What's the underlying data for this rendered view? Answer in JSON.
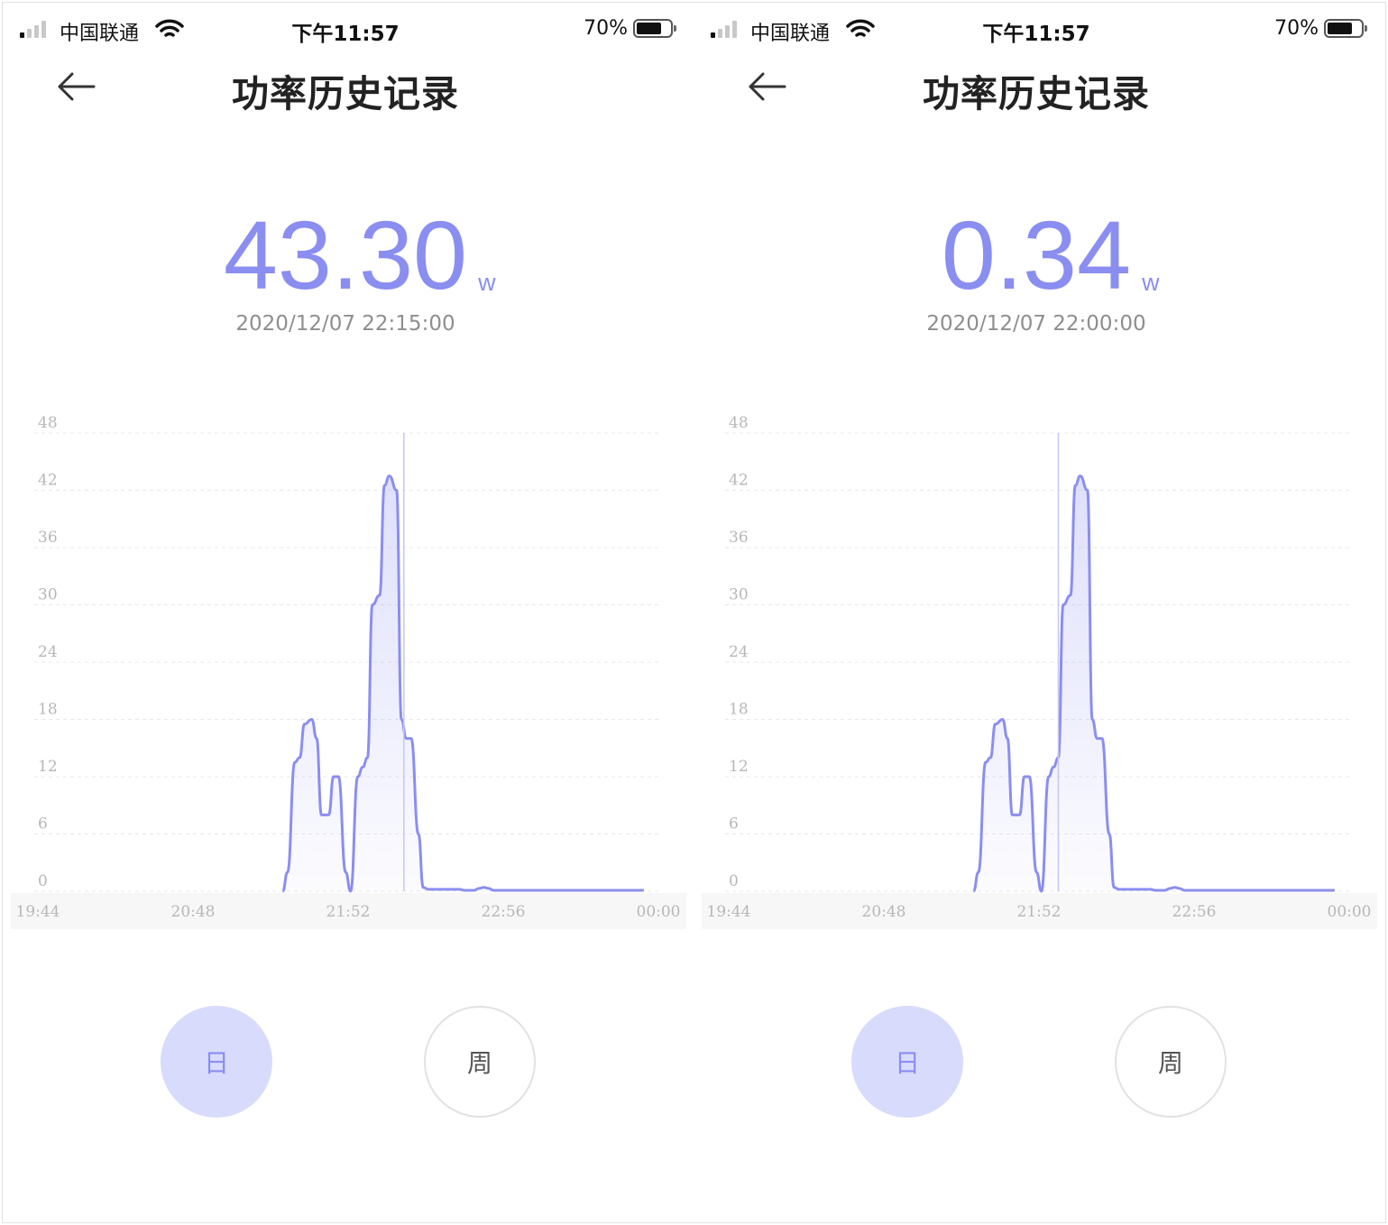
{
  "colors": {
    "accent": "#8a8ef0",
    "active_button_bg": "#d8dbfb",
    "grid": "#e8e8e8",
    "axis_text": "#b7b7b7"
  },
  "icons": [
    "signal-bars-icon",
    "wifi-icon",
    "battery-icon",
    "back-arrow-icon"
  ],
  "status_bar": {
    "carrier": "中国联通",
    "time": "下午11:57",
    "battery_percent": "70%"
  },
  "header": {
    "title": "功率历史记录"
  },
  "screens": [
    {
      "value": "43.30",
      "unit": "W",
      "timestamp": "2020/12/07 22:15:00",
      "buttons": {
        "day": "日",
        "week": "周",
        "selected": "day"
      },
      "cursor_time": "22:15"
    },
    {
      "value": "0.34",
      "unit": "W",
      "timestamp": "2020/12/07 22:00:00",
      "buttons": {
        "day": "日",
        "week": "周",
        "selected": "day"
      },
      "cursor_time": "22:00"
    }
  ],
  "chart_data": {
    "type": "area",
    "title": "",
    "xlabel": "",
    "ylabel": "",
    "y_ticks": [
      "0",
      "6",
      "12",
      "18",
      "24",
      "30",
      "36",
      "42",
      "48"
    ],
    "ylim": [
      0,
      48
    ],
    "x_ticks": [
      "19:44",
      "20:48",
      "21:52",
      "22:56",
      "00:00"
    ],
    "xlim": [
      "19:44",
      "00:00"
    ],
    "grid": "horizontal dashed",
    "series": [
      {
        "x": [
          "21:25",
          "21:27",
          "21:30",
          "21:32",
          "21:34",
          "21:37",
          "21:39",
          "21:41",
          "21:44",
          "21:46",
          "21:48",
          "21:51",
          "21:53",
          "21:56",
          "21:58",
          "22:00",
          "22:02",
          "22:05",
          "22:07",
          "22:09",
          "22:12",
          "22:14",
          "22:16",
          "22:18",
          "22:21",
          "22:23",
          "22:25",
          "22:28",
          "22:30",
          "22:32",
          "22:35",
          "22:38",
          "22:40",
          "22:44",
          "22:46",
          "22:48",
          "22:50",
          "22:52",
          "22:56",
          "23:06",
          "23:20",
          "23:40",
          "23:54"
        ],
        "values": [
          0,
          2,
          13.5,
          14,
          17.5,
          18,
          16,
          8,
          8,
          12,
          12,
          2,
          0,
          12,
          13,
          14,
          30,
          31,
          42.5,
          43.5,
          42,
          18,
          16,
          16,
          6,
          0.4,
          0.2,
          0.2,
          0.2,
          0.2,
          0.2,
          0.2,
          0.1,
          0.1,
          0.3,
          0.4,
          0.3,
          0.1,
          0.1,
          0.1,
          0.1,
          0.1,
          0.1
        ]
      }
    ]
  }
}
